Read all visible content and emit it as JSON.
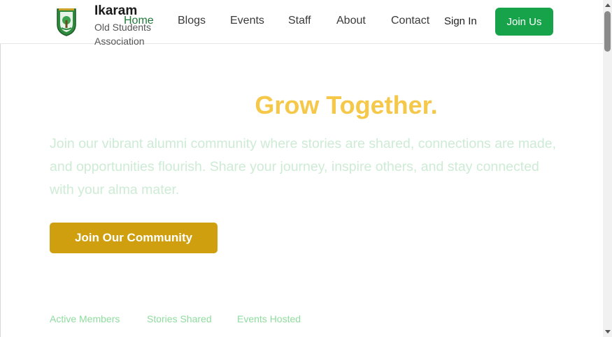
{
  "brand": {
    "name": "Ikaram",
    "subtitle": "Old Students Association"
  },
  "nav": {
    "items": [
      {
        "label": "Home",
        "active": true
      },
      {
        "label": "Blogs",
        "active": false
      },
      {
        "label": "Events",
        "active": false
      },
      {
        "label": "Staff",
        "active": false
      },
      {
        "label": "About",
        "active": false
      },
      {
        "label": "Contact",
        "active": false
      }
    ],
    "sign_in": "Sign In",
    "join_us": "Join Us"
  },
  "hero": {
    "headline": "Grow Together.",
    "description": "Join our vibrant alumni community where stories are shared, connections are made, and opportunities flourish. Share your journey, inspire others, and stay connected with your alma mater.",
    "cta_label": "Join Our Community"
  },
  "stats": {
    "labels": [
      "Active Members",
      "Stories Shared",
      "Events Hosted"
    ]
  },
  "colors": {
    "brand_green": "#16a34a",
    "active_nav": "#1f7a3a",
    "headline_yellow": "#f5c84a",
    "cta_gold": "#cf9f0f"
  }
}
